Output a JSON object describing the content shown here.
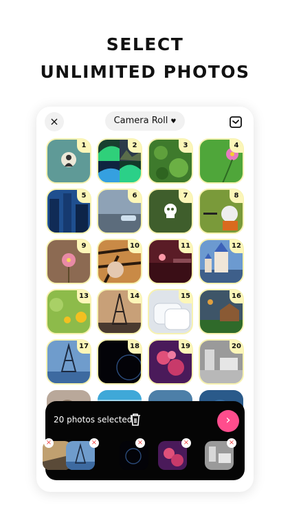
{
  "headline": {
    "line1": "SELECT",
    "line2": "UNLIMITED PHOTOS"
  },
  "topbar": {
    "close_icon": "×",
    "album_label": "Camera Roll",
    "caret": "♥"
  },
  "colors": {
    "badge": "#fcf6b8",
    "accent": "#ff4d8d",
    "tray": "#050505"
  },
  "grid": {
    "tiles": [
      {
        "n": "1"
      },
      {
        "n": "2"
      },
      {
        "n": "3"
      },
      {
        "n": "4"
      },
      {
        "n": "5"
      },
      {
        "n": "6"
      },
      {
        "n": "7"
      },
      {
        "n": "8"
      },
      {
        "n": "9"
      },
      {
        "n": "10"
      },
      {
        "n": "11"
      },
      {
        "n": "12"
      },
      {
        "n": "13"
      },
      {
        "n": "14"
      },
      {
        "n": "15"
      },
      {
        "n": "16"
      },
      {
        "n": "17"
      },
      {
        "n": "18"
      },
      {
        "n": "19"
      },
      {
        "n": "20"
      }
    ]
  },
  "tray": {
    "count_label": "20 photos selected",
    "next_label": "›",
    "remove_mark": "×"
  }
}
